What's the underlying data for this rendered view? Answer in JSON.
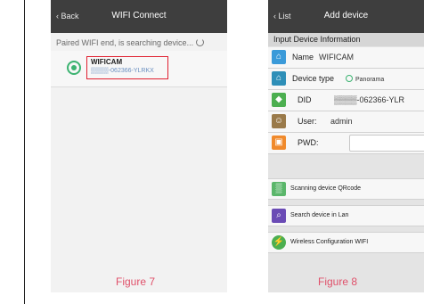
{
  "figure7": {
    "titlebar": {
      "back": "Back",
      "title": "WIFI Connect"
    },
    "status": "Paired WIFI end, is searching device...",
    "device": {
      "name": "WIFICAM",
      "id_blurred": "▒▒▒▒-062366-YLRKX"
    },
    "caption": "Figure 7"
  },
  "figure8": {
    "titlebar": {
      "back": "List",
      "title": "Add device"
    },
    "section_title": "Input Device Information",
    "fields": {
      "name_label": "Name",
      "name_value": "WIFICAM",
      "type_label": "Device type",
      "type_value": "Panorama",
      "did_label": "DID",
      "did_value": "▒▒▒▒-062366-YLR",
      "user_label": "User:",
      "user_value": "admin",
      "pwd_label": "PWD:",
      "pwd_value": ""
    },
    "actions": {
      "qr": "Scanning device QRcode",
      "lan": "Search device in Lan",
      "wifi": "Wireless Configuration WIFI"
    },
    "caption": "Figure 8",
    "colors": {
      "titlebar": "#3e3e3e",
      "caption": "#e0506a",
      "highlight": "#e02030",
      "green": "#3cb371"
    }
  }
}
